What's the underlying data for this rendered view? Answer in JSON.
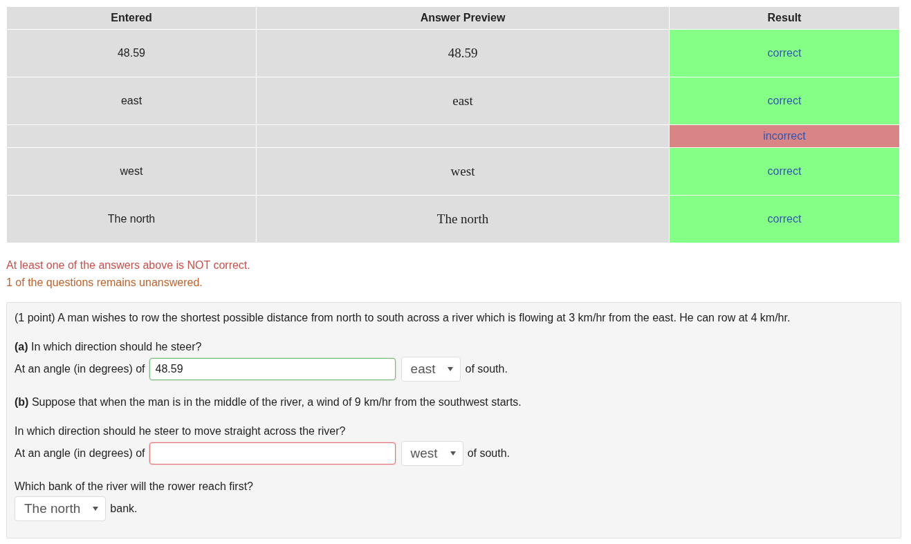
{
  "results_table": {
    "columns": [
      "Entered",
      "Answer Preview",
      "Result"
    ],
    "rows": [
      {
        "entered": "48.59",
        "preview": "48.59",
        "result": "correct",
        "correct": true
      },
      {
        "entered": "east",
        "preview": "east",
        "result": "correct",
        "correct": true
      },
      {
        "result": "incorrect",
        "correct": false
      },
      {
        "entered": "west",
        "preview": "west",
        "result": "correct",
        "correct": true
      },
      {
        "entered": "The north",
        "preview": "The north",
        "result": "correct",
        "correct": true
      }
    ]
  },
  "messages": [
    {
      "kind": "error",
      "text": "At least one of the answers above is NOT correct."
    },
    {
      "kind": "warning",
      "text": "1 of the questions remains unanswered."
    }
  ],
  "problem": {
    "intro": "(1 point) A man wishes to row the shortest possible distance from north to south across a river which is flowing at 3 km/hr from the east. He can row at 4 km/hr.",
    "items": [
      {
        "kind": "text",
        "text": "**(a)** In which direction should he steer?"
      },
      {
        "kind": "answer",
        "prompt": "At an angle (in degrees) of",
        "input": {
          "value": "48.59",
          "correct": true
        },
        "select": "east",
        "suffix": "of south."
      },
      {
        "kind": "text",
        "text": "**(b)** Suppose that when the man is in the middle of the river, a wind of 9 km/hr from the southwest starts."
      },
      {
        "kind": "text",
        "text": "In which direction should he steer to move straight across the river?"
      },
      {
        "kind": "answer",
        "prompt": "At an angle (in degrees) of",
        "input": {
          "correct": false
        },
        "select": "west",
        "suffix": "of south."
      },
      {
        "kind": "text",
        "text": "Which bank of the river will the rower reach first?"
      },
      {
        "kind": "choice",
        "select": "The north",
        "suffix": "bank."
      }
    ]
  }
}
